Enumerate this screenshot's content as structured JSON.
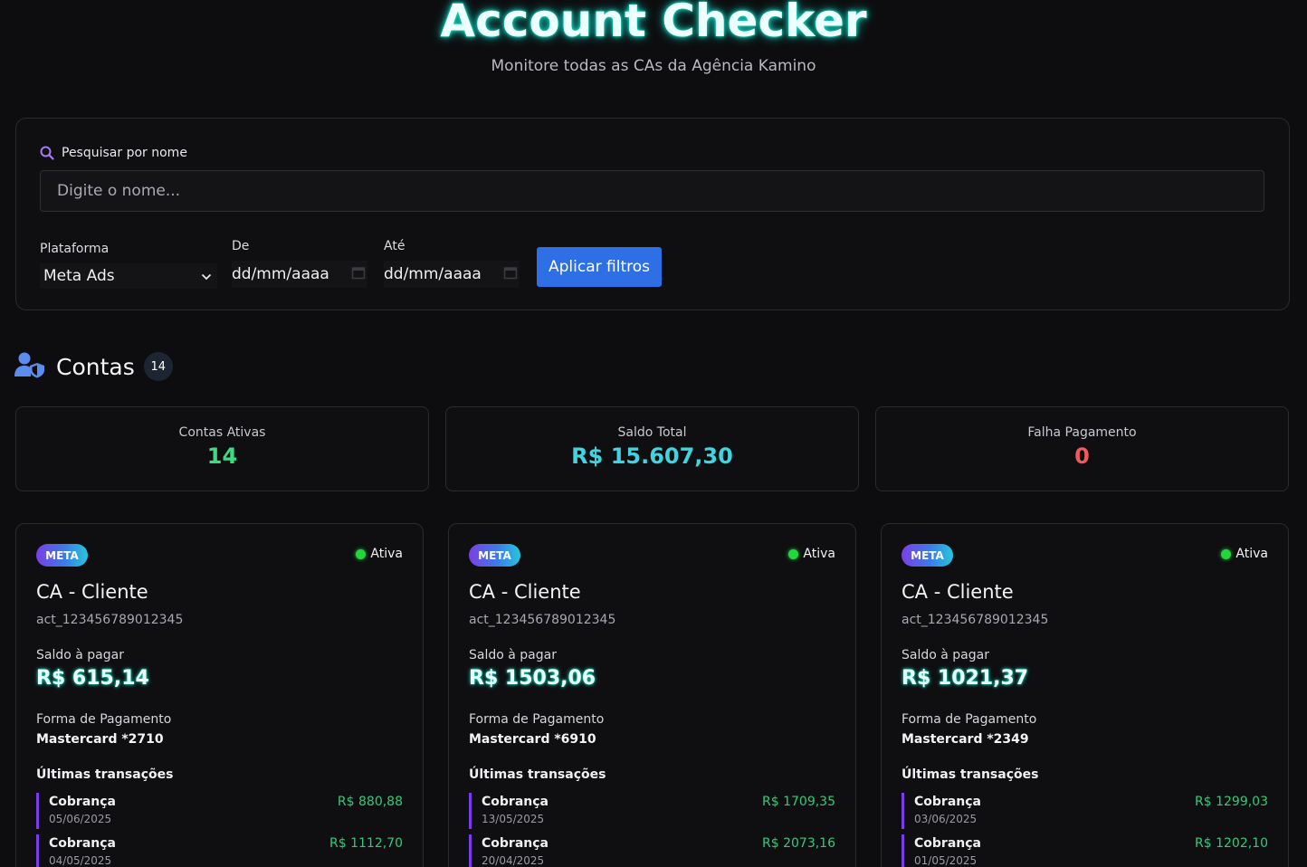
{
  "header": {
    "title": "Account Checker",
    "subtitle": "Monitore todas as CAs da Agência Kamino"
  },
  "filters": {
    "search_label": "Pesquisar por nome",
    "search_placeholder": "Digite o nome...",
    "search_value": "",
    "platform_label": "Plataforma",
    "platform_value": "Meta Ads",
    "from_label": "De",
    "from_value": "dd/mm/aaaa",
    "to_label": "Até",
    "to_value": "dd/mm/aaaa",
    "apply_label": "Aplicar filtros"
  },
  "accounts_section": {
    "title": "Contas",
    "count": "14",
    "icon": "user-shield-icon"
  },
  "stats": [
    {
      "label": "Contas Ativas",
      "value": "14",
      "color": "#3ddc84"
    },
    {
      "label": "Saldo Total",
      "value": "R$ 15.607,30",
      "color": "#3fd4e0"
    },
    {
      "label": "Falha Pagamento",
      "value": "0",
      "color": "#ef5b5b"
    }
  ],
  "cards": [
    {
      "platform": "META",
      "status": "Ativa",
      "name": "CA - Cliente",
      "account_id": "act_123456789012345",
      "balance_label": "Saldo à pagar",
      "balance": "R$ 615,14",
      "payment_label": "Forma de Pagamento",
      "payment": "Mastercard *2710",
      "tx_label": "Últimas transações",
      "transactions": [
        {
          "type": "Cobrança",
          "date": "05/06/2025",
          "amount": "R$ 880,88"
        },
        {
          "type": "Cobrança",
          "date": "04/05/2025",
          "amount": "R$ 1112,70"
        }
      ]
    },
    {
      "platform": "META",
      "status": "Ativa",
      "name": "CA - Cliente",
      "account_id": "act_123456789012345",
      "balance_label": "Saldo à pagar",
      "balance": "R$ 1503,06",
      "payment_label": "Forma de Pagamento",
      "payment": "Mastercard *6910",
      "tx_label": "Últimas transações",
      "transactions": [
        {
          "type": "Cobrança",
          "date": "13/05/2025",
          "amount": "R$ 1709,35"
        },
        {
          "type": "Cobrança",
          "date": "20/04/2025",
          "amount": "R$ 2073,16"
        }
      ]
    },
    {
      "platform": "META",
      "status": "Ativa",
      "name": "CA - Cliente",
      "account_id": "act_123456789012345",
      "balance_label": "Saldo à pagar",
      "balance": "R$ 1021,37",
      "payment_label": "Forma de Pagamento",
      "payment": "Mastercard *2349",
      "tx_label": "Últimas transações",
      "transactions": [
        {
          "type": "Cobrança",
          "date": "03/06/2025",
          "amount": "R$ 1299,03"
        },
        {
          "type": "Cobrança",
          "date": "01/05/2025",
          "amount": "R$ 1202,10"
        }
      ]
    }
  ]
}
